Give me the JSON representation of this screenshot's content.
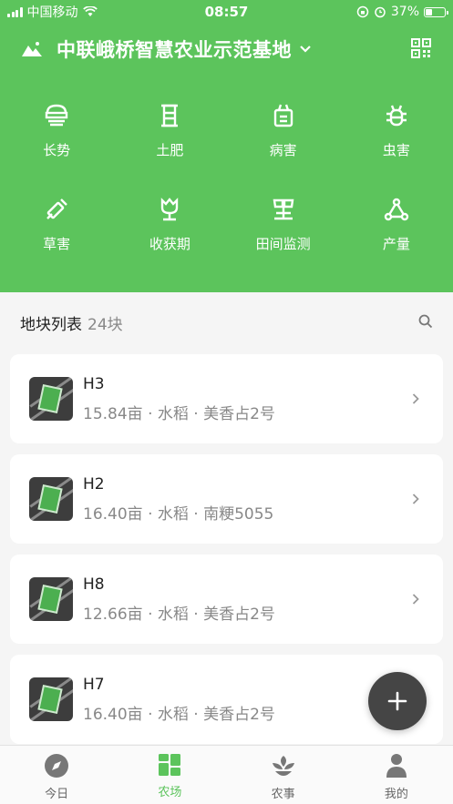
{
  "status_bar": {
    "carrier": "中国移动",
    "time": "08:57",
    "battery": "37%",
    "battery_level": 0.37
  },
  "header": {
    "farm_name": "中联峨桥智慧农业示范基地"
  },
  "features": [
    {
      "label": "长势",
      "icon": "greenhouse-icon"
    },
    {
      "label": "土肥",
      "icon": "soil-icon"
    },
    {
      "label": "病害",
      "icon": "disease-icon"
    },
    {
      "label": "虫害",
      "icon": "bug-icon"
    },
    {
      "label": "草害",
      "icon": "weed-icon"
    },
    {
      "label": "收获期",
      "icon": "harvest-icon"
    },
    {
      "label": "田间监测",
      "icon": "monitor-icon"
    },
    {
      "label": "产量",
      "icon": "yield-icon"
    }
  ],
  "plot_list": {
    "title": "地块列表",
    "count": "24块",
    "items": [
      {
        "name": "H3",
        "meta": "15.84亩 · 水稻 · 美香占2号"
      },
      {
        "name": "H2",
        "meta": "16.40亩 · 水稻 · 南粳5055"
      },
      {
        "name": "H8",
        "meta": "12.66亩 · 水稻 · 美香占2号"
      },
      {
        "name": "H7",
        "meta": "16.40亩 · 水稻 · 美香占2号"
      }
    ]
  },
  "tabbar": {
    "tabs": [
      {
        "label": "今日",
        "icon": "compass-icon"
      },
      {
        "label": "农场",
        "icon": "grid-icon",
        "active": true
      },
      {
        "label": "农事",
        "icon": "sprout-icon"
      },
      {
        "label": "我的",
        "icon": "user-icon"
      }
    ]
  },
  "colors": {
    "primary": "#5cc45c",
    "fab": "#454545"
  }
}
